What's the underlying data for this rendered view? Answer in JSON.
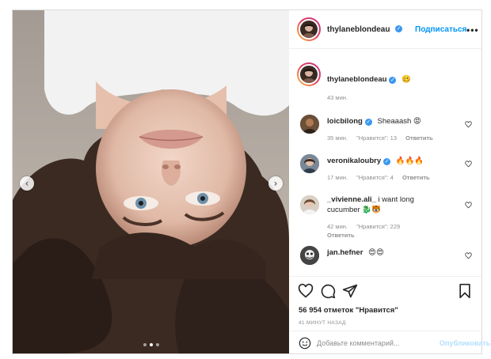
{
  "post": {
    "author": "thylaneblondeau",
    "verified_mark": "✓",
    "subscribe_label": "Подписаться",
    "more_label": "•••"
  },
  "caption": {
    "username": "thylaneblondeau",
    "text": "🥴",
    "time": "43 мин."
  },
  "comments": [
    {
      "username": "loicbilong",
      "verified": true,
      "text": "Sheaaash 😡",
      "time": "35 мин.",
      "likes": "\"Нравится\": 13",
      "reply": "Ответить"
    },
    {
      "username": "veronikaloubry",
      "verified": true,
      "text": "🔥🔥🔥",
      "time": "17 мин.",
      "likes": "\"Нравится\": 4",
      "reply": "Ответить"
    },
    {
      "username": "_vivienne.ali_",
      "verified": false,
      "text": "i want long cucumber 🐉🐯",
      "text_line2": "cucumber 🐉🐯",
      "time": "42 мин.",
      "likes": "\"Нравится\": 229",
      "reply": "Ответить"
    },
    {
      "username": "jan.hefner",
      "verified": false,
      "text": "😍😍",
      "time": "",
      "likes": "",
      "reply": ""
    }
  ],
  "engagement": {
    "likes_text": "56 954 отметок \"Нравится\"",
    "time_ago": "41 МИНУТ НАЗАД"
  },
  "composer": {
    "placeholder": "Добавьте комментарий...",
    "publish_label": "Опубликовать"
  },
  "carousel": {
    "slide_count": 3,
    "active_slide": 2,
    "prev_symbol": "‹",
    "next_symbol": "›"
  },
  "icons": {
    "header_avatar": "avatar-icon",
    "like": "heart-icon",
    "comment": "comment-icon",
    "share": "paper-plane-icon",
    "save": "bookmark-icon",
    "emoji": "smiley-icon"
  },
  "colors": {
    "accent": "#0095f6",
    "publish_disabled": "#b2dffc",
    "verified": "#3897f0",
    "muted": "#8e8e8e"
  }
}
